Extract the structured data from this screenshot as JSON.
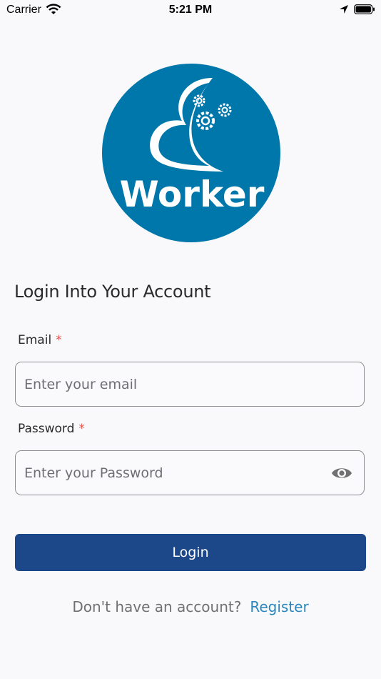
{
  "status_bar": {
    "carrier": "Carrier",
    "time": "5:21 PM"
  },
  "logo": {
    "text": "Worker",
    "color": "#0077aa"
  },
  "heading": "Login Into Your Account",
  "form": {
    "email_label": "Email",
    "email_required": "*",
    "email_placeholder": "Enter your email",
    "password_label": "Password",
    "password_required": "*",
    "password_placeholder": "Enter your Password",
    "login_label": "Login"
  },
  "footer": {
    "question": "Don't have an account?",
    "register": "Register"
  },
  "colors": {
    "primary": "#1c4788",
    "link": "#2a87bd",
    "required": "#e0524a"
  }
}
